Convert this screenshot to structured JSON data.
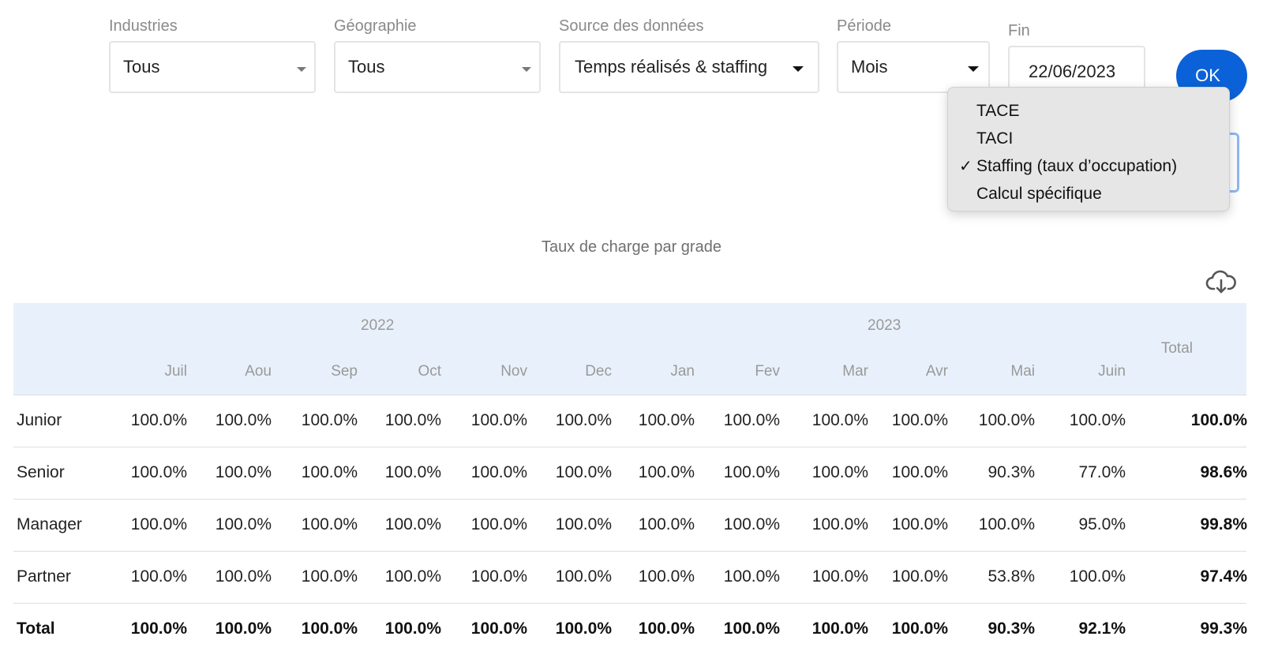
{
  "filters": {
    "industries": {
      "label": "Industries",
      "value": "Tous"
    },
    "geography": {
      "label": "Géographie",
      "value": "Tous"
    },
    "source": {
      "label": "Source des données",
      "value": "Temps réalisés & staffing"
    },
    "period": {
      "label": "Période",
      "value": "Mois"
    },
    "end": {
      "label": "Fin",
      "value": "22/06/2023"
    },
    "ok_label": "OK"
  },
  "dropdown": {
    "items": [
      {
        "label": "TACE",
        "checked": false
      },
      {
        "label": "TACI",
        "checked": false
      },
      {
        "label": "Staffing (taux d’occupation)",
        "checked": true
      },
      {
        "label": "Calcul spécifique",
        "checked": false
      }
    ],
    "check_glyph": "✓"
  },
  "chart_title": "Taux de charge par grade",
  "icons": {
    "download": "cloud-download-icon"
  },
  "table": {
    "years": [
      "2022",
      "2023"
    ],
    "months": [
      "Juil",
      "Aou",
      "Sep",
      "Oct",
      "Nov",
      "Dec",
      "Jan",
      "Fev",
      "Mar",
      "Avr",
      "Mai",
      "Juin"
    ],
    "total_header": "Total",
    "rows": [
      {
        "grade": "Junior",
        "values": [
          "100.0%",
          "100.0%",
          "100.0%",
          "100.0%",
          "100.0%",
          "100.0%",
          "100.0%",
          "100.0%",
          "100.0%",
          "100.0%",
          "100.0%",
          "100.0%"
        ],
        "total": "100.0%"
      },
      {
        "grade": "Senior",
        "values": [
          "100.0%",
          "100.0%",
          "100.0%",
          "100.0%",
          "100.0%",
          "100.0%",
          "100.0%",
          "100.0%",
          "100.0%",
          "100.0%",
          "90.3%",
          "77.0%"
        ],
        "total": "98.6%"
      },
      {
        "grade": "Manager",
        "values": [
          "100.0%",
          "100.0%",
          "100.0%",
          "100.0%",
          "100.0%",
          "100.0%",
          "100.0%",
          "100.0%",
          "100.0%",
          "100.0%",
          "100.0%",
          "95.0%"
        ],
        "total": "99.8%"
      },
      {
        "grade": "Partner",
        "values": [
          "100.0%",
          "100.0%",
          "100.0%",
          "100.0%",
          "100.0%",
          "100.0%",
          "100.0%",
          "100.0%",
          "100.0%",
          "100.0%",
          "53.8%",
          "100.0%"
        ],
        "total": "97.4%"
      }
    ],
    "total_row": {
      "grade": "Total",
      "values": [
        "100.0%",
        "100.0%",
        "100.0%",
        "100.0%",
        "100.0%",
        "100.0%",
        "100.0%",
        "100.0%",
        "100.0%",
        "100.0%",
        "90.3%",
        "92.1%"
      ],
      "total": "99.3%"
    }
  },
  "colors": {
    "accent": "#0b62d8",
    "header_bg": "#e8f1fb"
  }
}
